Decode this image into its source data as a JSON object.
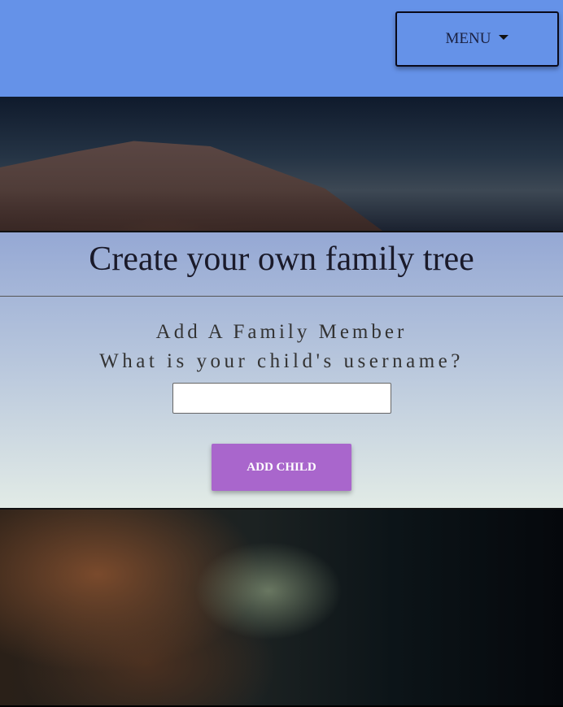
{
  "nav": {
    "menu_label": "MENU",
    "menu_icon": "caret-down-icon"
  },
  "main": {
    "title": "Create your own family tree",
    "subtitle": "Add A Family Member",
    "question": "What is your child's username?",
    "username_value": "",
    "add_button": "ADD CHILD"
  },
  "colors": {
    "nav": "#6592e8",
    "button": "#a966cc"
  }
}
